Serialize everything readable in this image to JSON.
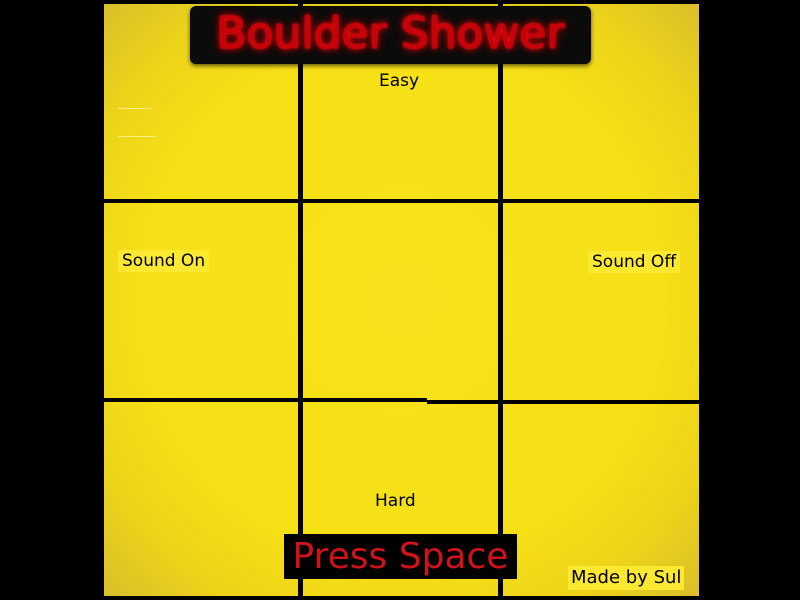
{
  "title": "Boulder Shower",
  "options": {
    "easy": "Easy",
    "hard": "Hard",
    "sound_on": "Sound On",
    "sound_off": "Sound Off"
  },
  "prompt": "Press Space",
  "credit": "Made by Sul",
  "colors": {
    "background": "#000000",
    "board": "#f6e016",
    "grid_lines": "#000000",
    "title_text": "#c8000a",
    "prompt_text": "#d0121b"
  }
}
